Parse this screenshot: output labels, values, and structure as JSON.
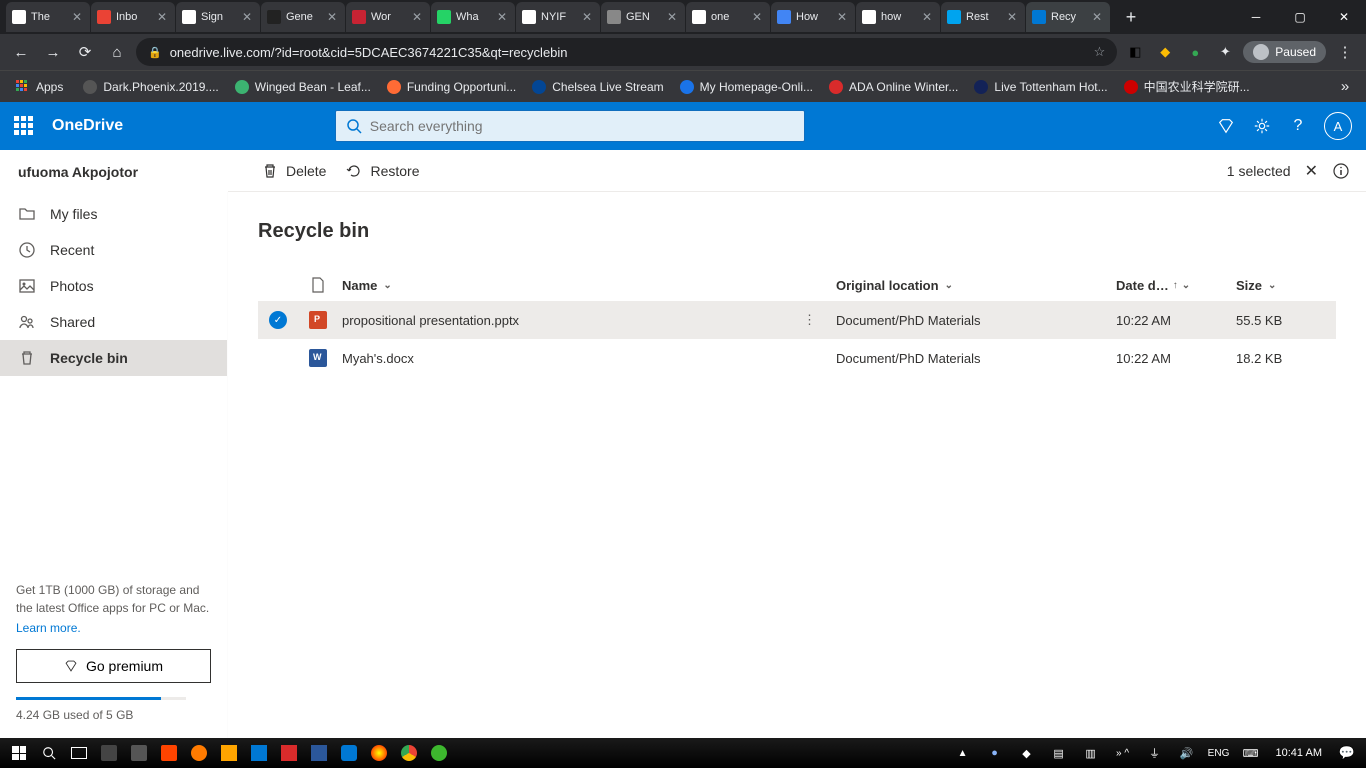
{
  "browser": {
    "tabs": [
      {
        "title": "The",
        "icon_bg": "#fff"
      },
      {
        "title": "Inbo",
        "icon_bg": "#ea4335"
      },
      {
        "title": "Sign",
        "icon_bg": "#fff"
      },
      {
        "title": "Gene",
        "icon_bg": "#222"
      },
      {
        "title": "Wor",
        "icon_bg": "#c82333"
      },
      {
        "title": "Wha",
        "icon_bg": "#25d366"
      },
      {
        "title": "NYIF",
        "icon_bg": "#fff"
      },
      {
        "title": "GEN",
        "icon_bg": "#888"
      },
      {
        "title": "one",
        "icon_bg": "#fff"
      },
      {
        "title": "How",
        "icon_bg": "#4285f4"
      },
      {
        "title": "how",
        "icon_bg": "#fff"
      },
      {
        "title": "Rest",
        "icon_bg": "#00a4ef"
      },
      {
        "title": "Recy",
        "icon_bg": "#0078d4",
        "active": true
      }
    ],
    "url": "onedrive.live.com/?id=root&cid=5DCAEC3674221C35&qt=recyclebin",
    "paused": "Paused"
  },
  "bookmarks": [
    {
      "label": "Apps",
      "icon": "#e8eaed"
    },
    {
      "label": "Dark.Phoenix.2019....",
      "icon": "#555"
    },
    {
      "label": "Winged Bean - Leaf...",
      "icon": "#3cb371"
    },
    {
      "label": "Funding Opportuni...",
      "icon": "#ff6b35"
    },
    {
      "label": "Chelsea Live Stream",
      "icon": "#034694"
    },
    {
      "label": "My Homepage-Onli...",
      "icon": "#1a73e8"
    },
    {
      "label": "ADA Online Winter...",
      "icon": "#d92b2b"
    },
    {
      "label": "Live Tottenham Hot...",
      "icon": "#132257"
    },
    {
      "label": "中国农业科学院研...",
      "icon": "#c00"
    }
  ],
  "app": {
    "name": "OneDrive"
  },
  "search": {
    "placeholder": "Search everything"
  },
  "user": {
    "name": "ufuoma Akpojotor",
    "initial": "A"
  },
  "sidebar": {
    "items": [
      {
        "label": "My files",
        "icon": "folder"
      },
      {
        "label": "Recent",
        "icon": "recent"
      },
      {
        "label": "Photos",
        "icon": "photos"
      },
      {
        "label": "Shared",
        "icon": "shared"
      },
      {
        "label": "Recycle bin",
        "icon": "recycle",
        "active": true
      }
    ],
    "promo": "Get 1TB (1000 GB) of storage and the latest Office apps for PC or Mac.",
    "learn_more": "Learn more.",
    "premium": "Go premium",
    "storage_text": "4.24 GB used of 5 GB",
    "storage_pct": 85
  },
  "commandbar": {
    "delete": "Delete",
    "restore": "Restore",
    "selected": "1 selected"
  },
  "page": {
    "title": "Recycle bin"
  },
  "table": {
    "cols": {
      "name": "Name",
      "location": "Original location",
      "date": "Date d…",
      "size": "Size"
    },
    "rows": [
      {
        "selected": true,
        "type": "pptx",
        "name": "propositional presentation.pptx",
        "location": "Document/PhD Materials",
        "date": "10:22 AM",
        "size": "55.5 KB"
      },
      {
        "selected": false,
        "type": "docx",
        "name": "Myah's.docx",
        "location": "Document/PhD Materials",
        "date": "10:22 AM",
        "size": "18.2 KB"
      }
    ]
  },
  "taskbar": {
    "clock": "10:41 AM"
  }
}
